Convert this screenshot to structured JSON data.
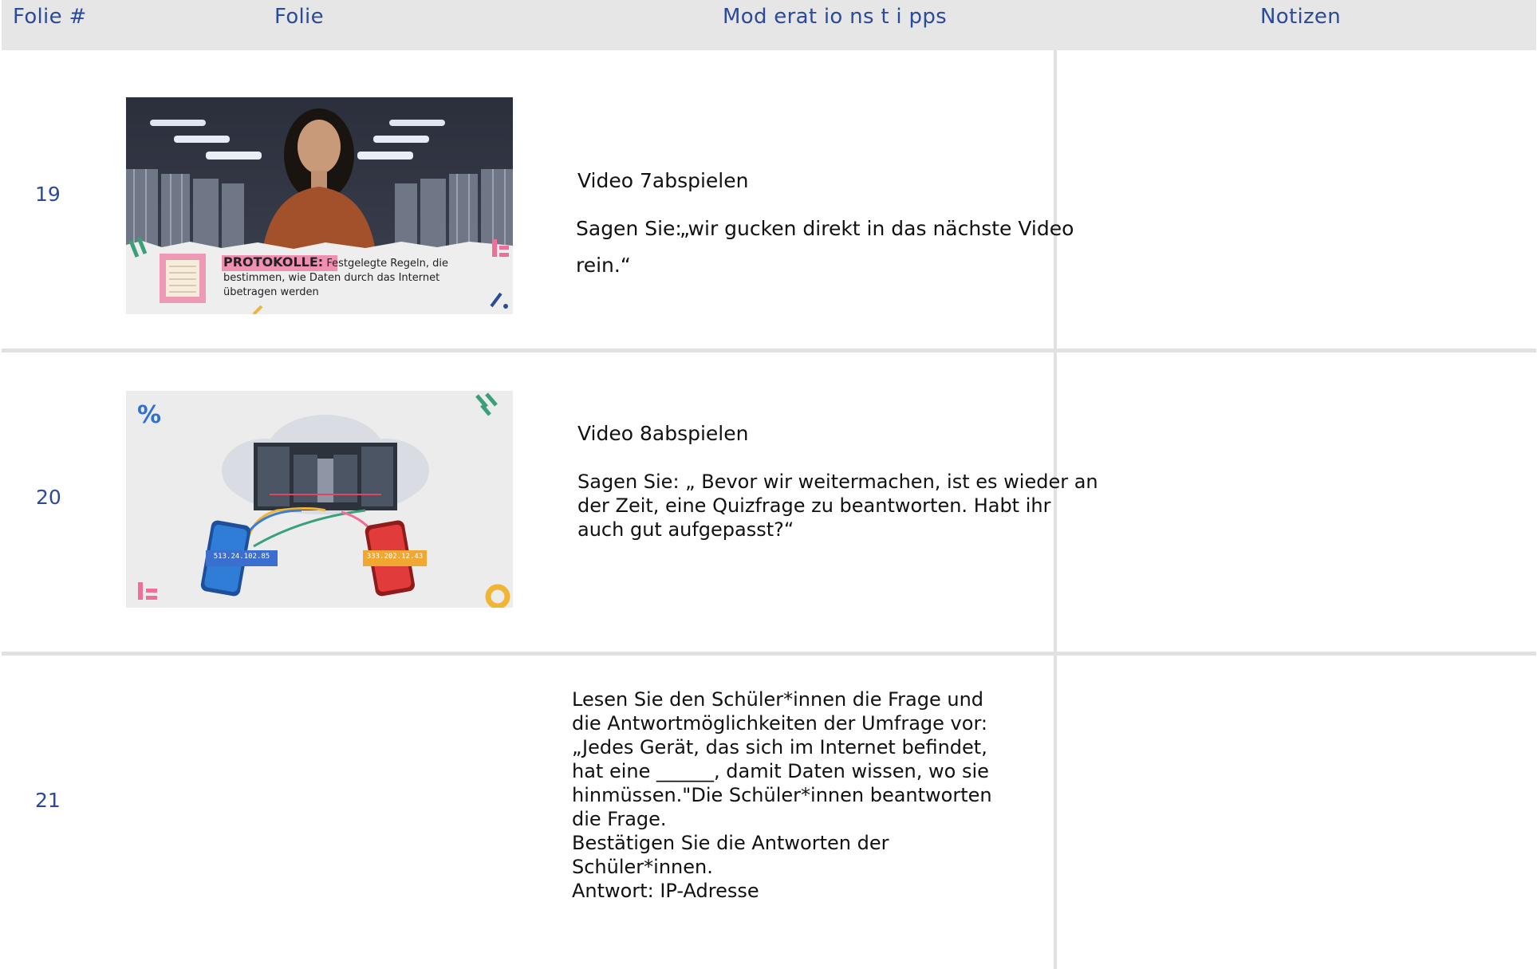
{
  "header": {
    "col_number": "Folie #",
    "col_slide": "Folie",
    "col_tips": "Mod erat io ns t i pps",
    "col_notes": "Notizen"
  },
  "rows": [
    {
      "number": "19",
      "tips_title": "Video 7abspielen",
      "tips_say_prefix": "Sagen Sie:",
      "tips_say_text": "„wir gucken direkt in das nächste Video",
      "tips_say_text2": "rein.“",
      "thumb_caption_bold": "PROTOKOLLE:",
      "thumb_caption_line1": "Festgelegte Regeln, die",
      "thumb_caption_line2": "bestimmen, wie Daten durch das Internet",
      "thumb_caption_line3": "übetragen werden"
    },
    {
      "number": "20",
      "tips_title": "Video 8abspielen",
      "tips_say_text": "Sagen Sie: „ Bevor wir weitermachen, ist es wieder an\nder Zeit, eine Quizfrage zu beantworten. Habt ihr\nauch gut aufgepasst?“",
      "thumb_ip_left": "513.24.102.85",
      "thumb_ip_right": "333.202.12.43"
    },
    {
      "number": "21",
      "tips_text": "Lesen Sie den Schüler*innen die Frage und\ndie Antwortmöglichkeiten der Umfrage vor:\n„Jedes Gerät, das sich im Internet befindet,\nhat eine ______, damit Daten wissen, wo sie\nhinmüssen.\"Die Schüler*innen beantworten\ndie Frage.\nBestätigen Sie die Antworten der\nSchüler*innen.\nAntwort: IP-Adresse"
    }
  ],
  "colors": {
    "header_bg": "#e6e6e6",
    "header_text": "#2c4a9a",
    "grid_line": "#e1e1e1"
  }
}
